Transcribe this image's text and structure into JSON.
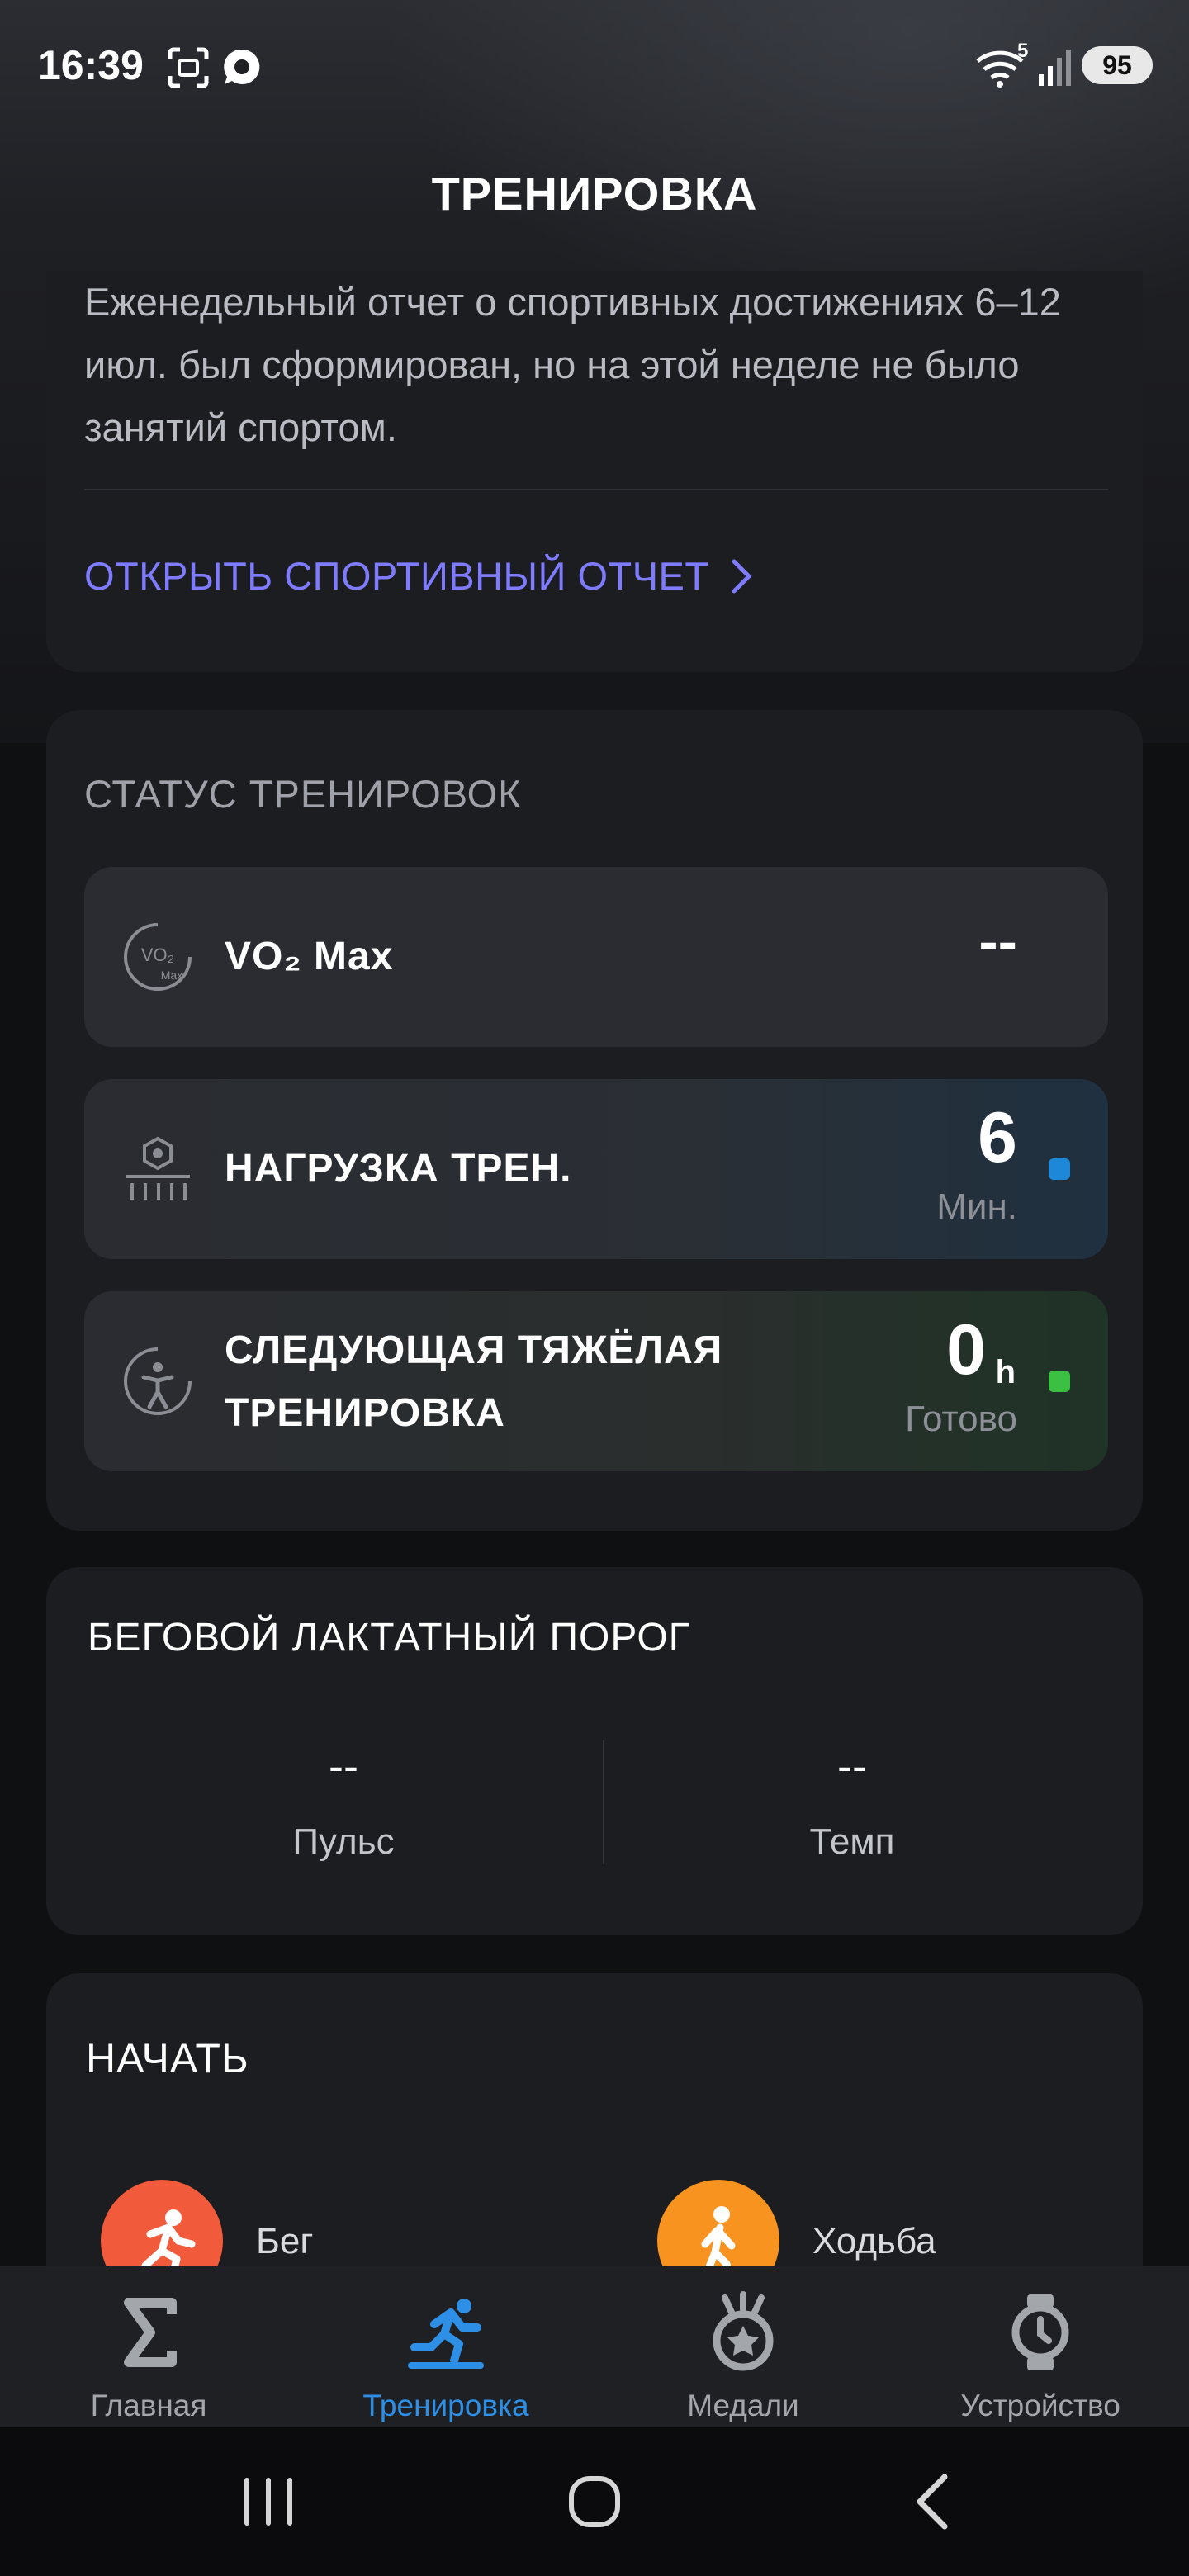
{
  "status_bar": {
    "time": "16:39",
    "wifi_badge": "5",
    "battery": "95",
    "icons": [
      "screenshot-icon",
      "chat-bubble-icon",
      "wifi-icon",
      "signal-icon",
      "battery-icon"
    ]
  },
  "header": {
    "title": "ТРЕНИРОВКА"
  },
  "weekly_report": {
    "text": "Еженедельный отчет о спортивных достижениях 6–12 июл. был сформирован, но на этой неделе не было занятий спортом.",
    "link_label": "ОТКРЫТЬ СПОРТИВНЫЙ ОТЧЕТ"
  },
  "training_status": {
    "section_title": "СТАТУС ТРЕНИРОВОК",
    "vo2": {
      "label": "VO₂ Max",
      "value": "--",
      "icon_text": "VO₂",
      "icon_sub": "Max"
    },
    "load": {
      "label": "НАГРУЗКА ТРЕН.",
      "value": "6",
      "unit": "Мин.",
      "dot_color": "#1e88d8"
    },
    "next_hard": {
      "label_line1": "СЛЕДУЮЩАЯ ТЯЖЁЛАЯ",
      "label_line2": "ТРЕНИРОВКА",
      "value": "0",
      "value_suffix": "h",
      "status": "Готово",
      "dot_color": "#3cc043"
    }
  },
  "lactate_threshold": {
    "title": "БЕГОВОЙ ЛАКТАТНЫЙ ПОРОГ",
    "pulse_value": "--",
    "pulse_label": "Пульс",
    "pace_value": "--",
    "pace_label": "Темп"
  },
  "start": {
    "title": "НАЧАТЬ",
    "activities": [
      {
        "label": "Бег",
        "color": "#f15a3b"
      },
      {
        "label": "Ходьба",
        "color": "#f7931e"
      }
    ]
  },
  "bottom_nav": {
    "items": [
      {
        "label": "Главная",
        "icon": "sigma-icon"
      },
      {
        "label": "Тренировка",
        "icon": "workout-icon",
        "active": true
      },
      {
        "label": "Медали",
        "icon": "medal-icon"
      },
      {
        "label": "Устройство",
        "icon": "watch-icon"
      }
    ],
    "active_color": "#2e8fe6"
  },
  "system_nav": {
    "buttons": [
      "recents-button",
      "home-button",
      "back-button"
    ]
  }
}
